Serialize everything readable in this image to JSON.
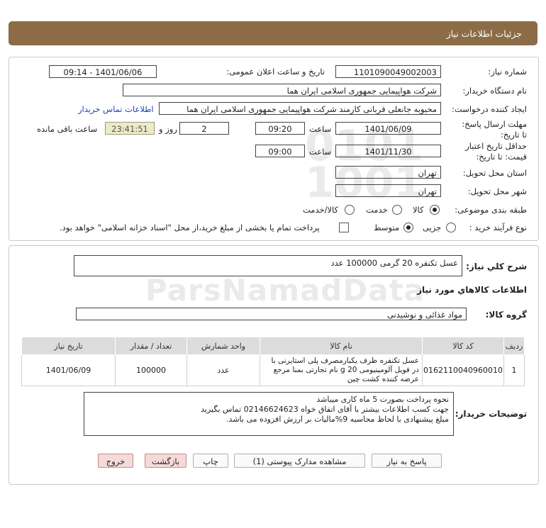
{
  "header": {
    "title": "جزئیات اطلاعات نیاز"
  },
  "form": {
    "need_number_label": "شماره نیاز:",
    "need_number": "1101090049002003",
    "announce_label": "تاریخ و ساعت اعلان عمومی:",
    "announce_value": "1401/06/06 - 09:14",
    "buyer_org_label": "نام دستگاه خریدار:",
    "buyer_org": "شرکت هواپیمایی جمهوری اسلامی ایران هما",
    "requester_label": "ایجاد کننده درخواست:",
    "requester": "محبوبه جانعلی قربانی کارمند شرکت هواپیمایی جمهوری اسلامی ایران هما",
    "contact_link": "اطلاعات تماس خریدار",
    "deadline_label": "مهلت ارسال پاسخ: تا تاریخ:",
    "deadline_date": "1401/06/09",
    "time_label": "ساعت",
    "deadline_time": "09:20",
    "days_value": "2",
    "days_label": "روز و",
    "remaining_time": "23:41:51",
    "remaining_label": "ساعت باقی مانده",
    "validity_label": "حداقل تاریخ اعتبار قیمت: تا تاریخ:",
    "validity_date": "1401/11/30",
    "validity_time": "09:00",
    "delivery_province_label": "استان محل تحویل:",
    "delivery_province": "تهران",
    "delivery_city_label": "شهر محل تحویل:",
    "delivery_city": "تهران",
    "category_label": "طبقه بندی موضوعی:",
    "category_options": [
      "کالا",
      "خدمت",
      "کالا/خدمت"
    ],
    "process_label": "نوع فرآیند خرید :",
    "process_options": [
      "جزیی",
      "متوسط"
    ],
    "payment_note": "پرداخت تمام یا بخشی از مبلغ خرید،از محل \"اسناد خزانه اسلامی\" خواهد بود."
  },
  "summary": {
    "desc_label": "شرح کلي نياز:",
    "desc_value": "عسل تکنفره 20 گرمی  100000 عدد",
    "goods_info_title": "اطلاعات کالاهاي مورد نياز",
    "group_label": "گروه کالا:",
    "group_value": "مواد غذائی و نوشیدنی"
  },
  "table": {
    "headers": [
      "ردیف",
      "کد کالا",
      "نام کالا",
      "واحد شمارش",
      "تعداد / مقدار",
      "تاریخ نیاز"
    ],
    "rows": [
      [
        "1",
        "0162110040960010",
        "عسل تکنفره ظرف یکبارمصرف پلی استایرنی با در فویل آلومینیومی 20 g نام تجارتی بمنا مرجع عرضه کننده کشت چین",
        "عدد",
        "100000",
        "1401/06/09"
      ]
    ]
  },
  "notes": {
    "label": "توضیحات خریدار:",
    "lines": [
      "نحوه پرداخت بصورت 5 ماه کاری میباشد",
      "جهت کسب اطلاعات بیشتر با آقای اتفاق خواه 02146624623 تماس بگیرید",
      "مبلغ پیشنهادی با لحاظ محاسبه 9%مالیات بر ارزش افزوده می باشد."
    ]
  },
  "buttons": {
    "reply": "پاسخ به نیاز",
    "attachments": "مشاهده مدارک پیوستی (1)",
    "print": "چاپ",
    "back": "بازگشت",
    "exit": "خروج"
  }
}
